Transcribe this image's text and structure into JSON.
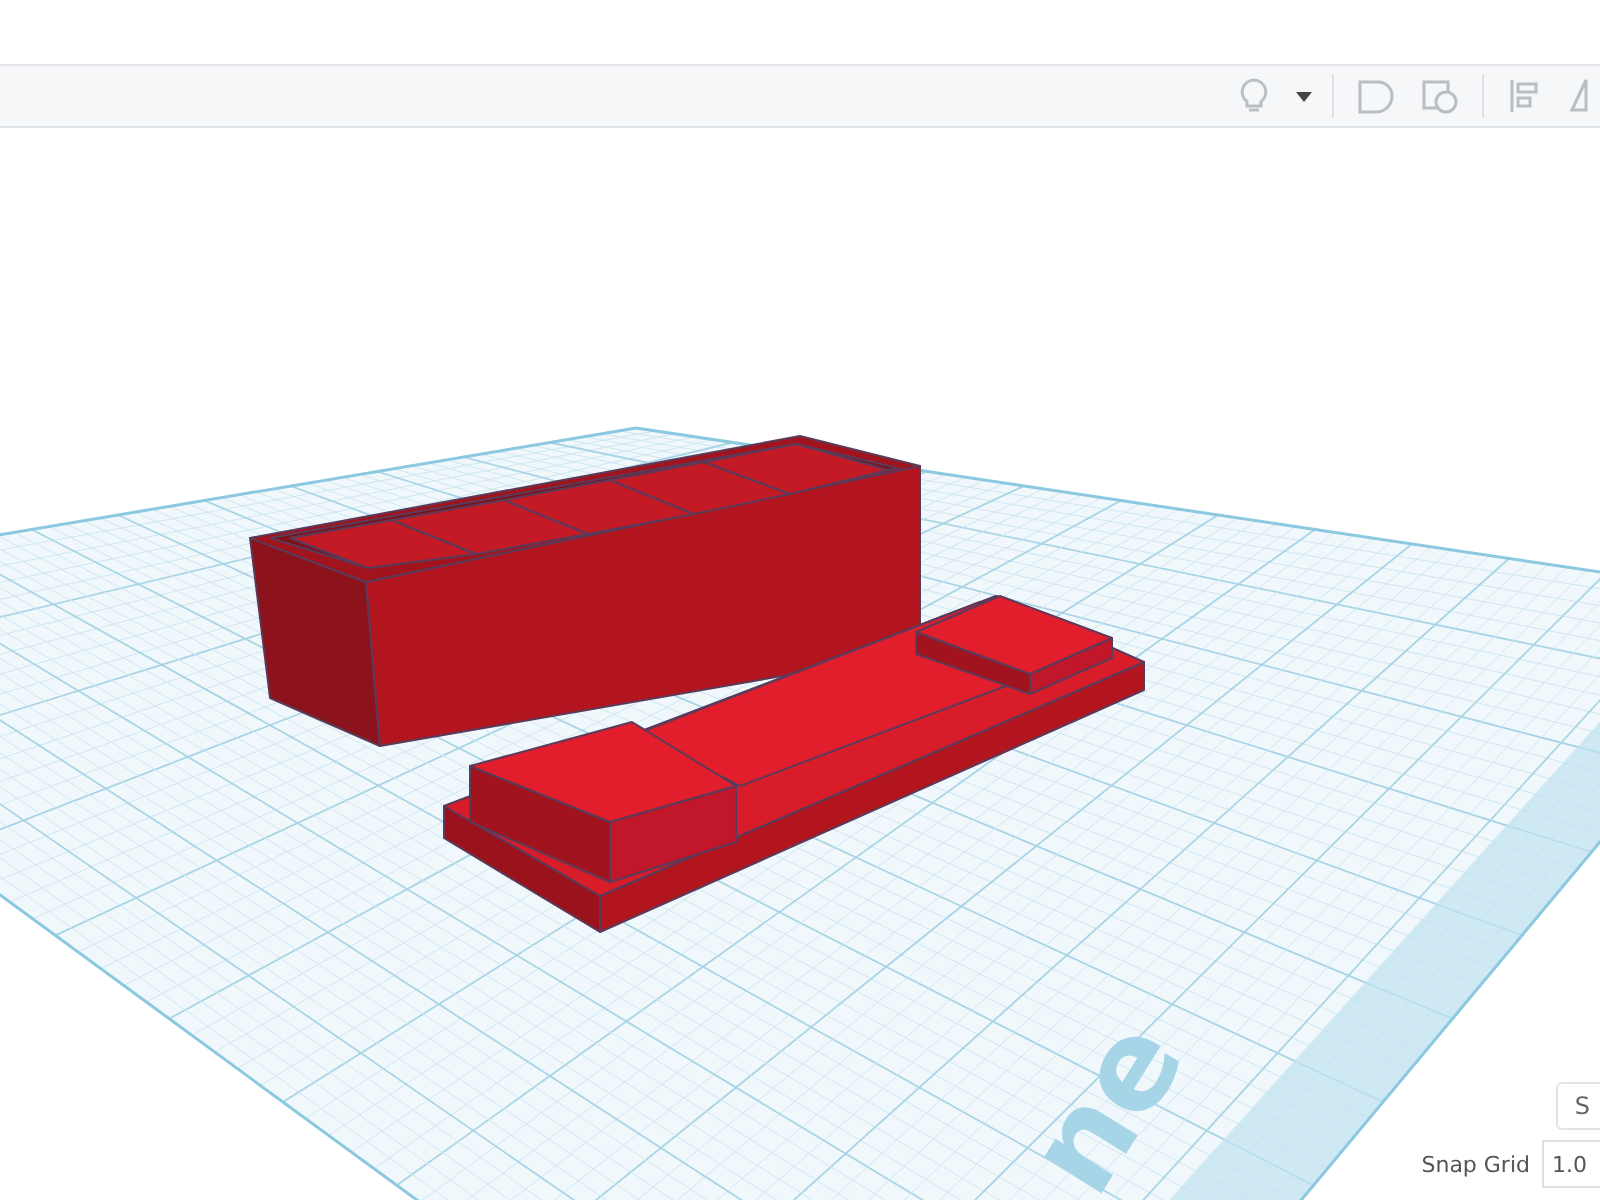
{
  "workplane": {
    "label": "ne"
  },
  "settings_button": {
    "label": "S"
  },
  "snap_grid": {
    "label": "Snap Grid",
    "value": "1.0"
  }
}
